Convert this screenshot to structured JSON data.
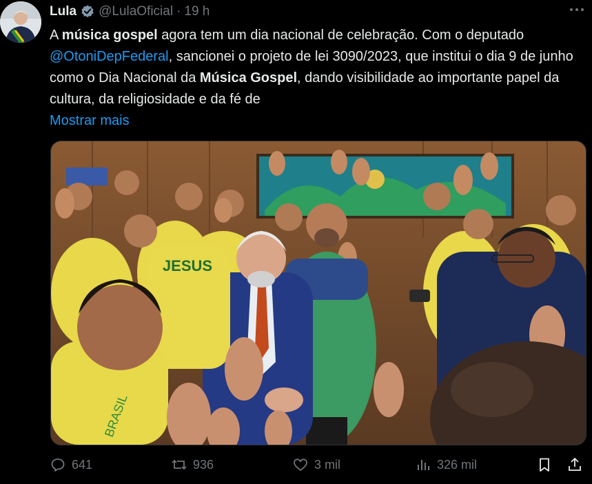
{
  "author": {
    "name": "Lula",
    "handle": "@LulaOficial",
    "time": "19 h"
  },
  "tweet": {
    "p1": "A ",
    "b1": "música gospel",
    "p2": " agora tem um dia nacional de celebração. Com o deputado ",
    "mention": "@OtoniDepFederal",
    "p3": ", sancionei o projeto de lei 3090/2023, que institui o dia 9 de junho como o Dia Nacional da ",
    "b2": "Música Gospel",
    "p4": ", dando visibilidade ao importante papel da cultura, da religiosidade e da fé de",
    "show_more": "Mostrar mais"
  },
  "media": {
    "shirt_text": "JESUS"
  },
  "actions": {
    "replies": "641",
    "retweets": "936",
    "likes": "3 mil",
    "views": "326 mil"
  },
  "icons": {
    "more": "more-icon",
    "verified": "verified-badge-icon",
    "reply": "reply-icon",
    "retweet": "retweet-icon",
    "like": "heart-icon",
    "views": "views-icon",
    "bookmark": "bookmark-icon",
    "share": "share-icon"
  },
  "colors": {
    "background": "#000000",
    "text": "#e7e9ea",
    "muted": "#71767b",
    "link": "#1d9bf0"
  }
}
